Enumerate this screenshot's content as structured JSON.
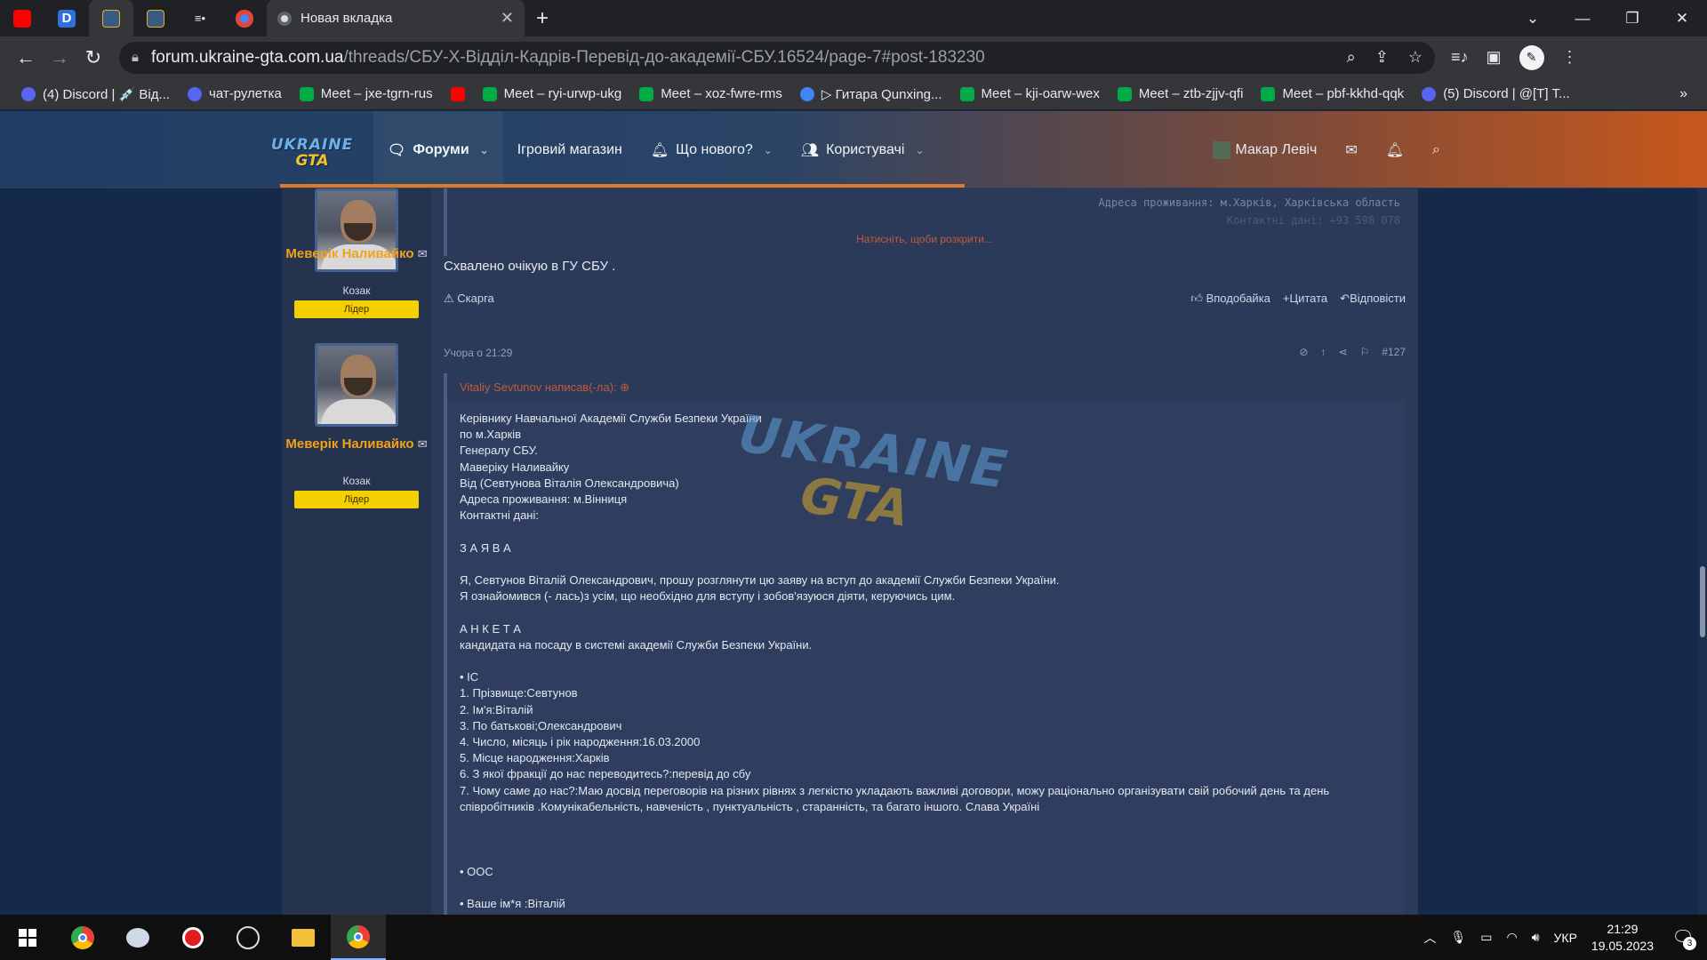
{
  "browser": {
    "active_tab_title": "Новая вкладка",
    "url_host": "forum.ukraine-gta.com.ua",
    "url_path": "/threads/СБУ-Х-Відділ-Кадрів-Перевід-до-академії-СБУ.16524/page-7#post-183230"
  },
  "bookmarks": [
    {
      "label": "(4) Discord | 💉 Від...",
      "icon": "discord-icon",
      "color": "#5865f2"
    },
    {
      "label": "чат-рулетка",
      "icon": "discord-icon",
      "color": "#5865f2"
    },
    {
      "label": "Meet – jxe-tgrn-rus",
      "icon": "meet-icon",
      "color": "#00ac47"
    },
    {
      "label": "",
      "icon": "youtube-icon",
      "color": "#ff0000"
    },
    {
      "label": "Meet – ryi-urwp-ukg",
      "icon": "meet-icon",
      "color": "#00ac47"
    },
    {
      "label": "Meet – xoz-fwre-rms",
      "icon": "meet-icon",
      "color": "#00ac47"
    },
    {
      "label": "▷ Гитара Qunxing...",
      "icon": "globe-icon",
      "color": "#4285f4"
    },
    {
      "label": "Meet – kji-oarw-wex",
      "icon": "meet-icon",
      "color": "#00ac47"
    },
    {
      "label": "Meet – ztb-zjjv-qfi",
      "icon": "meet-icon",
      "color": "#00ac47"
    },
    {
      "label": "Meet – pbf-kkhd-qqk",
      "icon": "meet-icon",
      "color": "#00ac47"
    },
    {
      "label": "(5) Discord | @[T] Т...",
      "icon": "discord-icon",
      "color": "#5865f2"
    }
  ],
  "site": {
    "logo_line1": "UKRAINE",
    "logo_line2": "GTA",
    "nav": {
      "forums": "Форуми",
      "shop": "Ігровий магазин",
      "whats_new": "Що нового?",
      "users": "Користувачі"
    },
    "user_name": "Макар Левіч",
    "accent": "#e07a2a"
  },
  "post1": {
    "author": "Меверік Наливайко",
    "user_title": "Козак",
    "badge": "Лідер",
    "hidden_line1": "Адреса проживання: м.Харків, Харківська область",
    "hidden_line2": "Контактні дані: +93 598 078",
    "reveal": "Натисніть, щоби розкрити...",
    "text": "Схвалено очікую в ГУ СБУ .",
    "report": "Скарга",
    "like": "Вподобайка",
    "quote": "Цитата",
    "reply": "Відповісти"
  },
  "post2": {
    "author": "Меверік Наливайко",
    "user_title": "Козак",
    "badge": "Лідер",
    "date": "Учора о 21:29",
    "number": "#127",
    "quote_author": "Vitaliy Sevtunov написав(-ла):",
    "quote_lines": [
      "Керівнику Навчальної Академії Служби Безпеки України",
      "по м.Харків",
      "Генералу СБУ.",
      "Маверіку Наливайку",
      "Від (Севтунова Віталія Олександровича)",
      "Адреса проживання: м.Вінниця",
      "Контактні дані:",
      "",
      "З А Я В А",
      "",
      "Я, Севтунов Віталій Олександрович, прошу розглянути цю заяву на вступ до академії Служби Безпеки України.",
      "Я ознайомився (- лась)з усім, що необхідно для вступу і зобов'язуюся діяти, керуючись цим.",
      "",
      "А Н К Е Т А",
      "кандидата на посаду в системі академії Служби Безпеки України.",
      "",
      "• IC",
      "1. Прізвище:Севтунов",
      "2. Ім'я:Віталій",
      "3. По батькові;Олександрович",
      "4. Число, місяць і рік народження:16.03.2000",
      "5. Місце народження:Харків",
      "6. З якої фракції до нас переводитесь?:перевід до сбу",
      "7. Чому саме до нас?:Маю досвід переговорів на різних рівнях з легкістю укладають важливі договори, можу раціонально організувати свій робочий день та день співробітників .Комунікабельність, навченість , пунктуальність , старанність, та багато іншого. Слава Україні",
      "",
      "",
      "",
      "• OOC",
      "",
      "• Ваше ім*я :Віталій"
    ],
    "watermark_line1": "UKRAINE",
    "watermark_line2": "GTA"
  },
  "taskbar": {
    "lang": "УКР",
    "time": "21:29",
    "date": "19.05.2023",
    "notifications": "3"
  }
}
